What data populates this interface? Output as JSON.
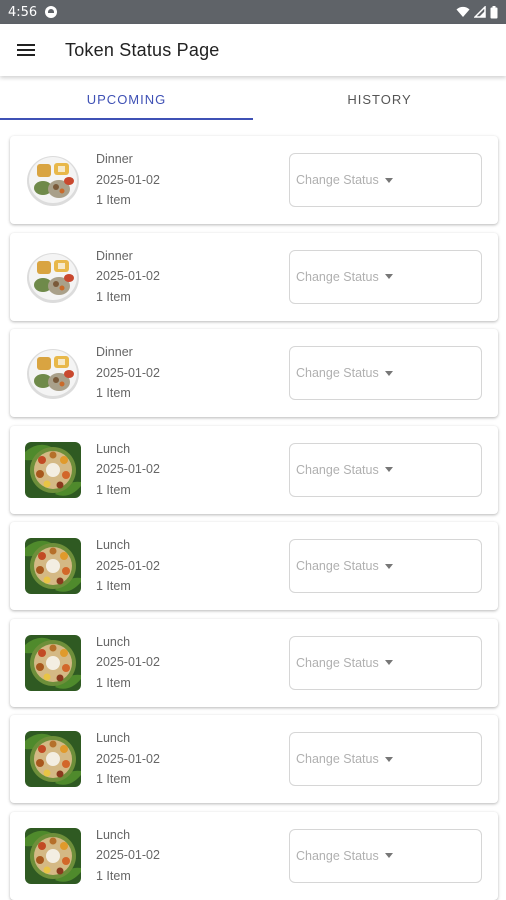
{
  "status_bar": {
    "time": "4:56",
    "icons": [
      "notification-icon",
      "wifi-icon",
      "signal-icon",
      "battery-icon"
    ]
  },
  "app_bar": {
    "title": "Token Status Page",
    "menu_icon": "menu-icon"
  },
  "tabs": [
    {
      "label": "UPCOMING",
      "active": true
    },
    {
      "label": "HISTORY",
      "active": false
    }
  ],
  "colors": {
    "accent": "#3f51b5",
    "status_bar": "#5f6368"
  },
  "tokens": [
    {
      "meal": "Dinner",
      "date": "2025-01-02",
      "items": "1 Item",
      "status_placeholder": "Change Status",
      "image": "dinner-plate-icon"
    },
    {
      "meal": "Dinner",
      "date": "2025-01-02",
      "items": "1 Item",
      "status_placeholder": "Change Status",
      "image": "dinner-plate-icon"
    },
    {
      "meal": "Dinner",
      "date": "2025-01-02",
      "items": "1 Item",
      "status_placeholder": "Change Status",
      "image": "dinner-plate-icon"
    },
    {
      "meal": "Lunch",
      "date": "2025-01-02",
      "items": "1 Item",
      "status_placeholder": "Change Status",
      "image": "lunch-plate-icon"
    },
    {
      "meal": "Lunch",
      "date": "2025-01-02",
      "items": "1 Item",
      "status_placeholder": "Change Status",
      "image": "lunch-plate-icon"
    },
    {
      "meal": "Lunch",
      "date": "2025-01-02",
      "items": "1 Item",
      "status_placeholder": "Change Status",
      "image": "lunch-plate-icon"
    },
    {
      "meal": "Lunch",
      "date": "2025-01-02",
      "items": "1 Item",
      "status_placeholder": "Change Status",
      "image": "lunch-plate-icon"
    },
    {
      "meal": "Lunch",
      "date": "2025-01-02",
      "items": "1 Item",
      "status_placeholder": "Change Status",
      "image": "lunch-plate-icon"
    }
  ]
}
